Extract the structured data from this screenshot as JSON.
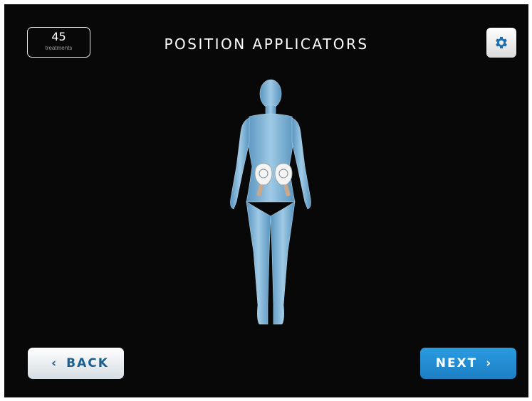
{
  "header": {
    "title": "POSITION APPLICATORS",
    "counter": {
      "value": "45",
      "label": "treatments"
    },
    "settings_icon": "gear-icon"
  },
  "body_figure": {
    "applicators_icon": "applicator-icon"
  },
  "footer": {
    "back_label": "BACK",
    "back_icon": "chevron-left-icon",
    "next_label": "NEXT",
    "next_icon": "chevron-right-icon"
  },
  "colors": {
    "background": "#080808",
    "accent": "#1d7fc4",
    "back_text": "#1a5f8f",
    "figure": "#8ec3e6"
  }
}
